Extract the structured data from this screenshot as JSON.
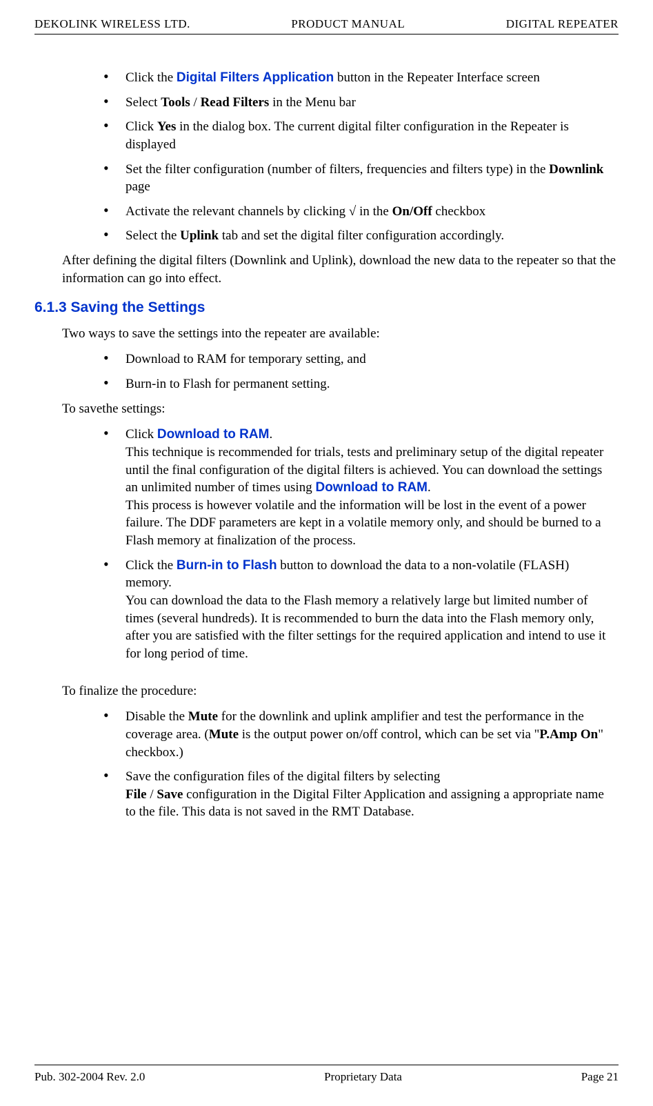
{
  "header": {
    "left": "DEKOLINK WIRELESS LTD.",
    "center": "PRODUCT MANUAL",
    "right": "DIGITAL REPEATER"
  },
  "bullets1": {
    "i0": {
      "pre": "Click the ",
      "link": "Digital Filters Application",
      "post": " button in the Repeater Interface screen"
    },
    "i1": {
      "a": "Select ",
      "b": "Tools",
      "c": " / ",
      "d": "Read Filters",
      "e": " in the Menu bar"
    },
    "i2": {
      "a": "Click ",
      "b": "Yes",
      "c": " in the dialog box.  The current digital filter configuration in the Repeater is displayed"
    },
    "i3": {
      "a": "Set the filter configuration (number of filters, frequencies and filters type) in the ",
      "b": "Downlink",
      "c": " page"
    },
    "i4": {
      "a": "Activate the relevant channels by clicking √ in the ",
      "b": "On/Off",
      "c": " checkbox"
    },
    "i5": {
      "a": "Select the ",
      "b": "Uplink",
      "c": " tab and set the digital  filter configuration accordingly."
    }
  },
  "para1": "After defining the digital filters (Downlink and Uplink), download the new data to the repeater so that the information can go into effect.",
  "heading": "6.1.3 Saving the Settings",
  "para2": "Two ways to save the settings into the repeater are available:",
  "bullets2": {
    "i0": "Download to RAM  for temporary setting, and",
    "i1": "Burn-in to Flash for permanent setting."
  },
  "para3": "To savethe settings:",
  "bullets3": {
    "i0": {
      "a": "Click ",
      "b": "Download to RAM",
      "c": ".",
      "d": "This technique is recommended for trials, tests and preliminary setup of the digital repeater until the final configuration of the digital filters is achieved.  You can download the settings an unlimited number of times using ",
      "e": "Download to RAM",
      "f": ".",
      "g": "This process is however volatile and the information will be lost in the event of a power failure. The DDF parameters are kept in a volatile memory only, and should be burned to a Flash memory at finalization of the process."
    },
    "i1": {
      "a": "Click the ",
      "b": "Burn-in to Flash",
      "c": " button to download the data to a non-volatile (FLASH) memory.",
      "d": "You can download the data to the Flash memory a relatively large but limited number of times (several hundreds).  It is recommended to burn the data into the Flash memory only, after you are satisfied with the filter settings for the required application and intend to use it for long period of time."
    }
  },
  "para4": "To finalize the procedure:",
  "bullets4": {
    "i0": {
      "a": "Disable the ",
      "b": "Mute",
      "c": " for the downlink and uplink amplifier and test the performance in the coverage area. (",
      "d": "Mute",
      "e": " is the output power on/off control, which can be set via \"",
      "f": "P.Amp On",
      "g": "\" checkbox.)"
    },
    "i1": {
      "a": "Save the configuration files of the digital filters by selecting ",
      "b": "File",
      "c": " / ",
      "d": "Save",
      "e": " configuration in the Digital Filter Application and assigning a appropriate name to the file. This data is not saved in the RMT Database."
    }
  },
  "footer": {
    "left": "Pub. 302-2004 Rev. 2.0",
    "center": "Proprietary Data",
    "right": "Page 21"
  }
}
